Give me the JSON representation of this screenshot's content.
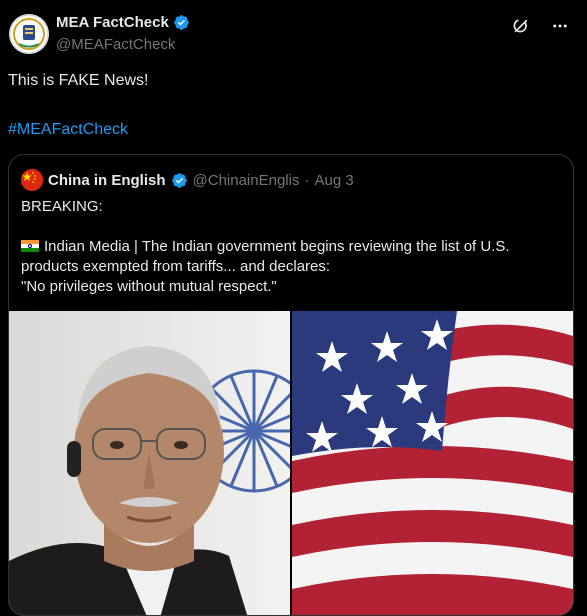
{
  "tweet": {
    "author": {
      "name": "MEA FactCheck",
      "handle": "@MEAFactCheck",
      "avatar_icon": "mea-emblem-logo",
      "verified": true
    },
    "text": "This is FAKE News!",
    "hashtag": "#MEAFactCheck",
    "actions": {
      "grok_icon": "grok-icon",
      "more_icon": "more-dots-icon"
    }
  },
  "quoted_tweet": {
    "author": {
      "name": "China in English",
      "handle": "@ChinainEnglis",
      "separator": "·",
      "date": "Aug 3",
      "avatar_icon": "china-flag-icon",
      "verified": true
    },
    "text_line1": "BREAKING:",
    "text_line2": "Indian Media | The Indian government begins reviewing the list of U.S. products exempted from tariffs... and declares:",
    "text_line3": "\"No privileges without mutual respect.\"",
    "images": [
      {
        "name": "official-portrait-photo"
      },
      {
        "name": "us-flag-photo"
      }
    ]
  },
  "colors": {
    "background": "#000000",
    "text": "#e7e9ea",
    "muted": "#71767b",
    "link": "#1d9bf0",
    "verified": "#1d9bf0",
    "border": "#2f3336"
  }
}
